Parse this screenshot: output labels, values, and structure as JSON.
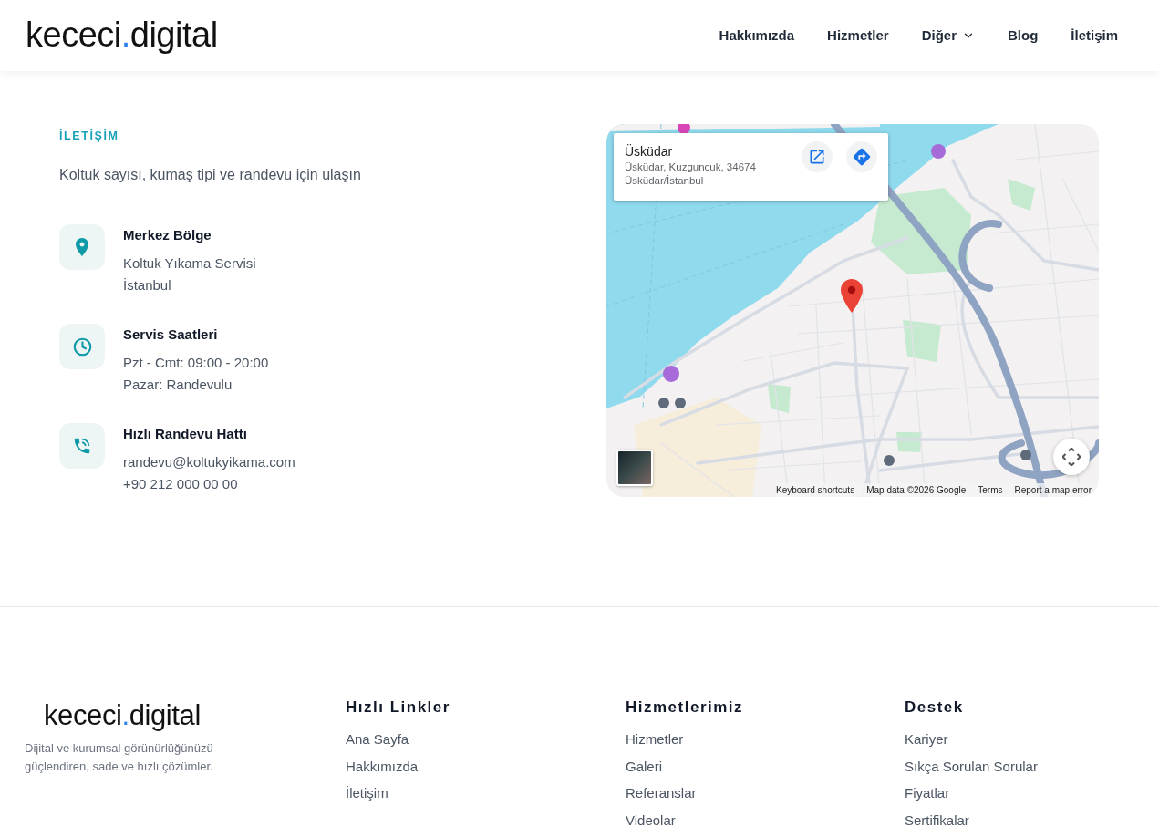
{
  "header": {
    "logo": {
      "name": "kececi",
      "dot": ".",
      "suffix": "digital"
    },
    "nav": [
      {
        "label": "Hakkımızda",
        "kind": "link"
      },
      {
        "label": "Hizmetler",
        "kind": "link"
      },
      {
        "label": "Diğer",
        "kind": "dropdown"
      },
      {
        "label": "Blog",
        "kind": "link"
      },
      {
        "label": "İletişim",
        "kind": "link"
      }
    ]
  },
  "contact": {
    "eyebrow": "İLETİŞİM",
    "intro": "Koltuk sayısı, kumaş tipi ve randevu için ulaşın",
    "items": [
      {
        "kind": "location",
        "title": "Merkez Bölge",
        "lines": [
          "Koltuk Yıkama Servisi",
          "İstanbul"
        ]
      },
      {
        "kind": "hours",
        "title": "Servis Saatleri",
        "lines": [
          "Pzt - Cmt: 09:00 - 20:00",
          "Pazar: Randevulu"
        ]
      },
      {
        "kind": "phone",
        "title": "Hızlı Randevu Hattı",
        "lines": [
          "randevu@koltukyikama.com",
          "+90 212 000 00 00"
        ]
      }
    ]
  },
  "map": {
    "info_card": {
      "title": "Üsküdar",
      "address_lines": [
        "Üsküdar, Kuzguncuk, 34674",
        "Üsküdar/İstanbul"
      ]
    },
    "attribution": [
      "Keyboard shortcuts",
      "Map data ©2026 Google",
      "Terms",
      "Report a map error"
    ]
  },
  "footer": {
    "logo": {
      "name": "kececi",
      "dot": ".",
      "suffix": "digital"
    },
    "tagline": "Dijital ve kurumsal görünürlüğünüzü güçlendiren, sade ve hızlı çözümler.",
    "columns": [
      {
        "title": "Hızlı Linkler",
        "links": [
          "Ana Sayfa",
          "Hakkımızda",
          "İletişim"
        ]
      },
      {
        "title": "Hizmetlerimiz",
        "links": [
          "Hizmetler",
          "Galeri",
          "Referanslar",
          "Videolar"
        ]
      },
      {
        "title": "Destek",
        "links": [
          "Kariyer",
          "Sıkça Sorulan Sorular",
          "Fiyatlar",
          "Sertifikalar"
        ]
      }
    ]
  }
}
